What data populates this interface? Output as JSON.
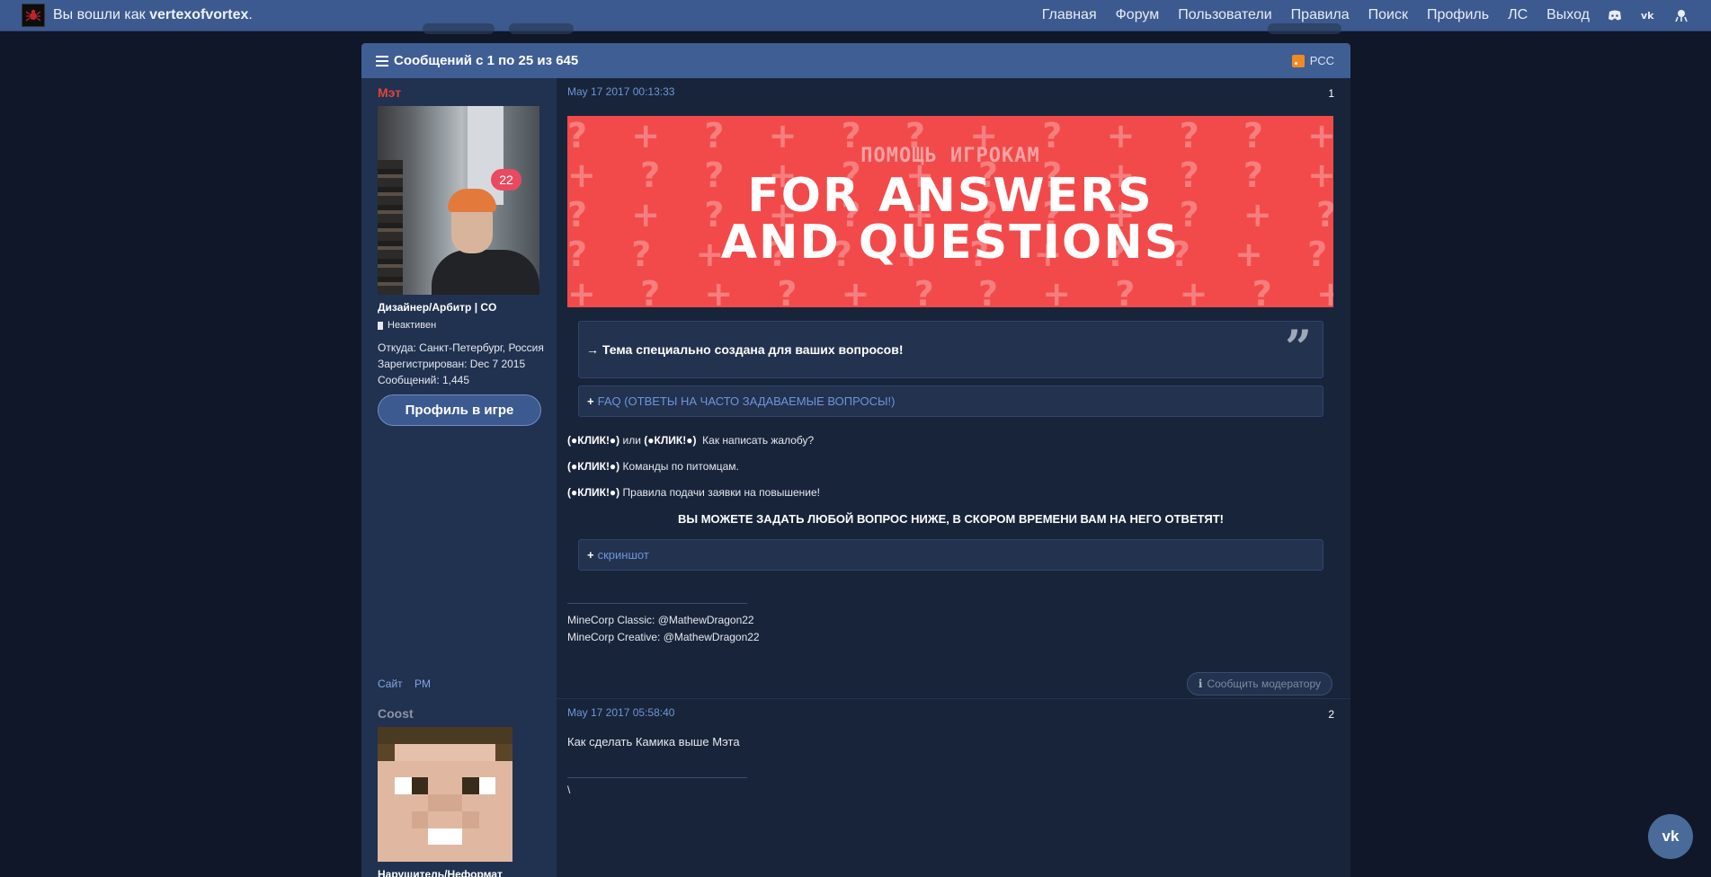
{
  "topbar": {
    "login_prefix": "Вы вошли как",
    "username": "vertexofvortex",
    "nav": [
      "Главная",
      "Форум",
      "Пользователи",
      "Правила",
      "Поиск",
      "Профиль",
      "ЛС",
      "Выход"
    ],
    "icons": [
      "discord-icon",
      "vk-icon",
      "theme-icon"
    ]
  },
  "panel": {
    "title": "Сообщений с 1 по 25 из 645",
    "rss_label": "РСС"
  },
  "posts": [
    {
      "author": "Мэт",
      "badge": "22",
      "rank": "Дизайнер/Арбитр | CO",
      "status": "Неактивен",
      "from": "Откуда: Санкт-Петербург, Россия",
      "registered": "Зарегистрирован: Dec 7 2015",
      "messages": "Сообщений: 1,445",
      "profile_button": "Профиль в игре",
      "links": [
        "Сайт",
        "PM"
      ],
      "date": "May 17 2017 00:13:33",
      "number": "1",
      "banner_sub": "ПОМОЩЬ ИГРОКАМ",
      "banner_main_1": "FOR ANSWERS",
      "banner_main_2": "AND QUESTIONS",
      "quote": "→ Тема специально создана для ваших вопросов!",
      "faq_spoiler": "FAQ (ОТВЕТЫ НА ЧАСТО ЗАДАВАЕМЫЕ ВОПРОСЫ!)",
      "line1_a": "(●КЛИК!●)",
      "line1_or": "или",
      "line1_b": "(●КЛИК!●)",
      "line1_text": "Как написать жалобу?",
      "line2_a": "(●КЛИК!●)",
      "line2_text": "Команды по питомцам.",
      "line3_a": "(●КЛИК!●)",
      "line3_text": "Правила подачи заявки на повышение!",
      "caps": "ВЫ МОЖЕТЕ ЗАДАТЬ ЛЮБОЙ ВОПРОС НИЖЕ, В СКОРОМ ВРЕМЕНИ ВАМ НА НЕГО ОТВЕТЯТ!",
      "screenshot_spoiler": "скриншот",
      "sig1": "MineCorp Classic: @MathewDragon22",
      "sig2": "MineCorp Creative: @MathewDragon22",
      "report": "Сообщить модератору"
    },
    {
      "author": "Coost",
      "rank": "Нарушитель/Неформат",
      "date": "May 17 2017 05:58:40",
      "number": "2",
      "body": "Как сделать Камика выше Мэта",
      "sig": "\\"
    }
  ],
  "colors": {
    "accent": "#3c5a8f",
    "background": "#0f1728",
    "author_red": "#e0443a",
    "banner_red": "#f24a4a"
  }
}
